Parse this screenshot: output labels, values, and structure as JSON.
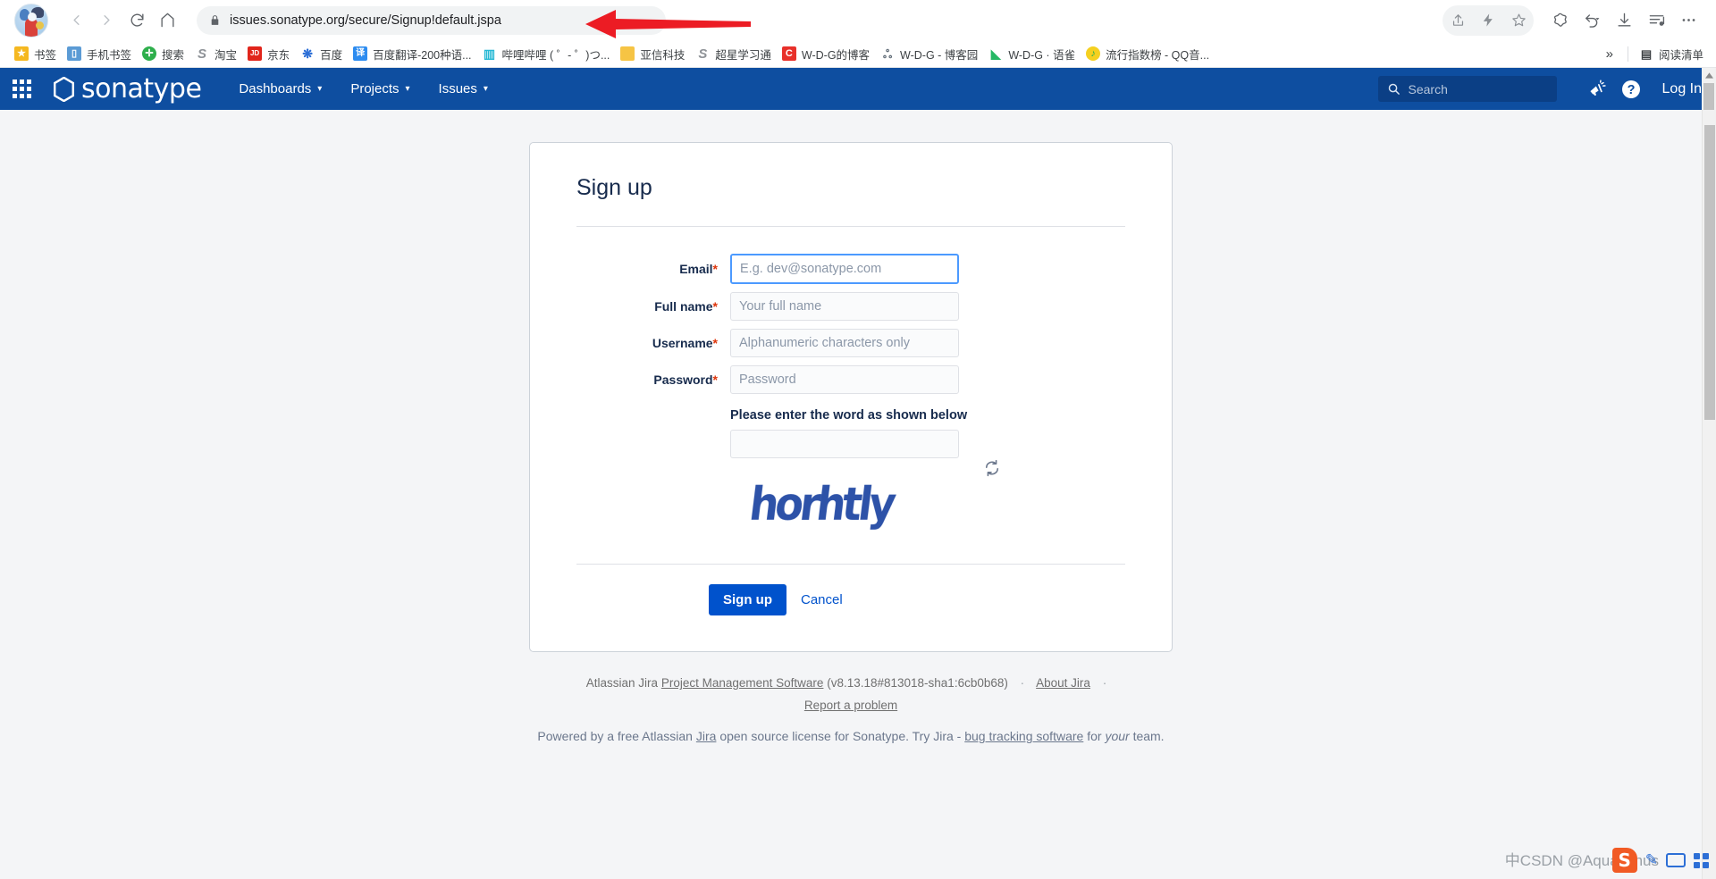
{
  "browser": {
    "url": "issues.sonatype.org/secure/Signup!default.jspa",
    "back_label": "Back",
    "forward_label": "Forward",
    "reload_label": "Reload",
    "home_label": "Home",
    "lock_icon": "lock-icon",
    "share_label": "Share",
    "flash_label": "Flash",
    "bookmark_star_label": "Bookmark",
    "collections_label": "Collections",
    "history_back_label": "History",
    "downloads_label": "Downloads",
    "reading_list_label": "Reading list",
    "more_label": "More"
  },
  "bookmarks": {
    "items": [
      {
        "label": "书签",
        "icon": "star-icon",
        "color": "#f5b820",
        "glyph": "★"
      },
      {
        "label": "手机书签",
        "icon": "phone-bookmark-icon",
        "color": "#5b9bd5",
        "glyph": "▯"
      },
      {
        "label": "搜索",
        "icon": "search-plus-icon",
        "color": "#2eaf4c",
        "glyph": "✛"
      },
      {
        "label": "淘宝",
        "icon": "taobao-icon",
        "color": "#8f9398",
        "glyph": "S"
      },
      {
        "label": "京东",
        "icon": "jd-icon",
        "color": "#e1251b",
        "glyph": "JD"
      },
      {
        "label": "百度",
        "icon": "baidu-icon",
        "color": "#2d6fd6",
        "glyph": "❋"
      },
      {
        "label": "百度翻译-200种语...",
        "icon": "baidu-translate-icon",
        "color": "#2d8cf0",
        "glyph": "译"
      },
      {
        "label": "哔哩哔哩 ( ゜- ゜)つ...",
        "icon": "bilibili-icon",
        "color": "#26b8d4",
        "glyph": "▥"
      },
      {
        "label": "亚信科技",
        "icon": "folder-icon",
        "color": "#f6c444",
        "glyph": "▤"
      },
      {
        "label": "超星学习通",
        "icon": "chaoxing-icon",
        "color": "#8f9398",
        "glyph": "S"
      },
      {
        "label": "W-D-G的博客",
        "icon": "csdn-icon",
        "color": "#e8302a",
        "glyph": "C"
      },
      {
        "label": "W-D-G - 博客园",
        "icon": "cnblogs-icon",
        "color": "#5a6672",
        "glyph": "ஃ"
      },
      {
        "label": "W-D-G · 语雀",
        "icon": "yuque-icon",
        "color": "#25b864",
        "glyph": "▰"
      },
      {
        "label": "流行指数榜 - QQ音...",
        "icon": "qqmusic-icon",
        "color": "#f5d020",
        "glyph": "♪"
      }
    ],
    "overflow_label": "»",
    "reading_list_label": "阅读清单",
    "reading_list_icon": "reading-list-icon"
  },
  "sonatype_nav": {
    "app_switcher_label": "App switcher",
    "brand": "sonatype",
    "brand_icon": "hexagon-logo-icon",
    "menu": [
      {
        "label": "Dashboards",
        "caret": "▾"
      },
      {
        "label": "Projects",
        "caret": "▾"
      },
      {
        "label": "Issues",
        "caret": "▾"
      }
    ],
    "search_placeholder": "Search",
    "search_icon": "search-icon",
    "announcement_icon": "megaphone-icon",
    "help_icon": "help-icon",
    "login_label": "Log In",
    "brand_color": "#0e4ea0"
  },
  "signup": {
    "title": "Sign up",
    "fields": [
      {
        "label": "Email",
        "required": "*",
        "placeholder": "E.g. dev@sonatype.com",
        "value": "",
        "focused": true,
        "name": "email-field"
      },
      {
        "label": "Full name",
        "required": "*",
        "placeholder": "Your full name",
        "value": "",
        "focused": false,
        "name": "fullname-field"
      },
      {
        "label": "Username",
        "required": "*",
        "placeholder": "Alphanumeric characters only",
        "value": "",
        "focused": false,
        "name": "username-field"
      },
      {
        "label": "Password",
        "required": "*",
        "placeholder": "Password",
        "value": "",
        "focused": false,
        "name": "password-field"
      }
    ],
    "captcha_prompt": "Please enter the word as shown below",
    "captcha_value": "",
    "captcha_placeholder": "",
    "captcha_word": "horhtly",
    "captcha_refresh_icon": "refresh-icon",
    "submit_label": "Sign up",
    "cancel_label": "Cancel",
    "primary_color": "#0052cc"
  },
  "footer": {
    "line1_prefix": "Atlassian Jira",
    "line1_link": "Project Management Software",
    "line1_version": "(v8.13.18#813018-sha1:6cb0b68)",
    "about_link": "About Jira",
    "report_link": "Report a problem",
    "dot": "·",
    "license_prefix": "Powered by a free Atlassian",
    "license_jira": "Jira",
    "license_mid": "open source license for Sonatype. Try Jira -",
    "license_link": "bug tracking software",
    "license_for": "for",
    "license_your": "your",
    "license_suffix": "team."
  },
  "watermark": {
    "text": "中CSDN @AquaMinus",
    "sogou_glyph": "S"
  }
}
